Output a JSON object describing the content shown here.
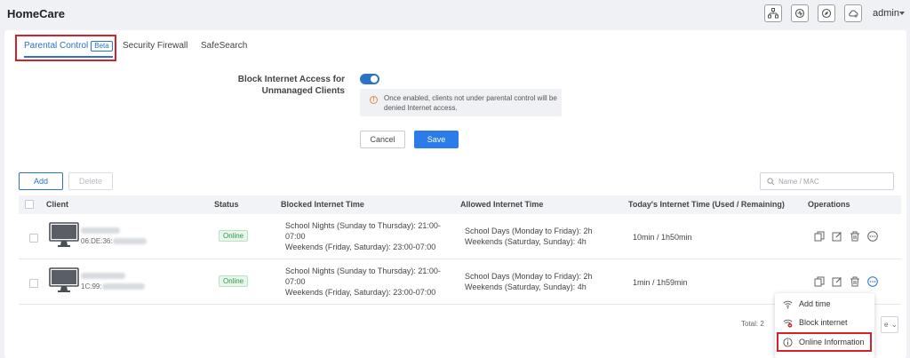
{
  "app": {
    "title": "HomeCare",
    "user": "admin"
  },
  "tabs": [
    {
      "label": "Parental Control",
      "badge": "Beta"
    },
    {
      "label": "Security Firewall"
    },
    {
      "label": "SafeSearch"
    }
  ],
  "setting": {
    "label": "Block Internet Access for Unmanaged Clients",
    "enabled": true,
    "notice": "Once enabled, clients not under parental control will be denied Internet access."
  },
  "buttons": {
    "cancel": "Cancel",
    "save": "Save",
    "add": "Add",
    "delete": "Delete"
  },
  "search": {
    "placeholder": "Name / MAC"
  },
  "table": {
    "columns": [
      "Client",
      "Status",
      "Blocked Internet Time",
      "Allowed Internet Time",
      "Today's Internet Time (Used / Remaining)",
      "Operations"
    ],
    "rows": [
      {
        "mac_prefix": "06:DE:36:",
        "status": "Online",
        "blocked_1": "School Nights (Sunday to Thursday): 21:00-",
        "blocked_2": "07:00",
        "blocked_3": "Weekends (Friday, Saturday): 23:00-07:00",
        "allowed_1": "School Days (Monday to Friday):  2h",
        "allowed_2": "Weekends (Saturday, Sunday):  4h",
        "today": "10min / 1h50min"
      },
      {
        "mac_prefix": "1C:99:",
        "status": "Online",
        "blocked_1": "School Nights (Sunday to Thursday): 21:00-",
        "blocked_2": "07:00",
        "blocked_3": "Weekends (Friday, Saturday): 23:00-07:00",
        "allowed_1": "School Days (Monday to Friday):  2h",
        "allowed_2": "Weekends (Saturday, Sunday):  4h",
        "today": "1min / 1h59min"
      }
    ]
  },
  "footer": {
    "total": "Total: 2",
    "pager_fragment": "e"
  },
  "menu": {
    "items": [
      {
        "label": "Add time",
        "icon": "wifi-icon"
      },
      {
        "label": "Block internet",
        "icon": "wifi-blocked-icon"
      },
      {
        "label": "Online Information",
        "icon": "info-circle-icon"
      }
    ]
  },
  "colors": {
    "accent": "#2b72c8",
    "highlight": "#d0232b",
    "online": "#2f9a4b"
  }
}
